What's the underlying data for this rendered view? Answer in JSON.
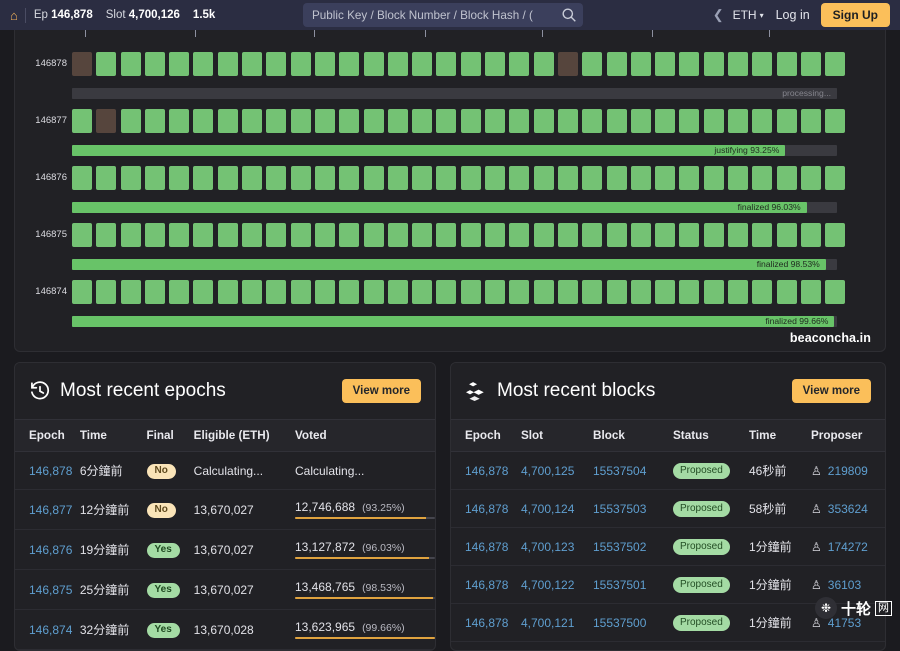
{
  "nav": {
    "home_icon": "home-icon",
    "epoch_label": "Ep",
    "epoch_value": "146,878",
    "slot_label": "Slot",
    "slot_value": "4,700,126",
    "peers": "1.5k",
    "search_placeholder": "Public Key / Block Number / Block Hash / (",
    "search_icon": "search-icon",
    "back_icon": "chevron-left-icon",
    "network": "ETH",
    "network_caret": "▾",
    "login": "Log in",
    "signup": "Sign Up"
  },
  "chart": {
    "watermark": "beaconcha.in",
    "slot_count": 32,
    "rows": [
      {
        "epoch": "146878",
        "missed_indexes": [
          0,
          20
        ],
        "bar_percent": 0,
        "bar_state": "idle",
        "bar_label": "processing..."
      },
      {
        "epoch": "146877",
        "missed_indexes": [
          1
        ],
        "bar_percent": 93.25,
        "bar_state": "justifying",
        "bar_label": "justifying 93.25%"
      },
      {
        "epoch": "146876",
        "missed_indexes": [],
        "bar_percent": 96.03,
        "bar_state": "finalized",
        "bar_label": "finalized 96.03%"
      },
      {
        "epoch": "146875",
        "missed_indexes": [],
        "bar_percent": 98.53,
        "bar_state": "finalized",
        "bar_label": "finalized 98.53%"
      },
      {
        "epoch": "146874",
        "missed_indexes": [],
        "bar_percent": 99.66,
        "bar_state": "finalized",
        "bar_label": "finalized 99.66%"
      }
    ]
  },
  "epochs_card": {
    "icon": "history-clock-icon",
    "title": "Most recent epochs",
    "view_more": "View more",
    "columns": [
      "Epoch",
      "Time",
      "Final",
      "Eligible (ETH)",
      "Voted"
    ],
    "rows": [
      {
        "epoch": "146,878",
        "time": "6分鐘前",
        "final": "No",
        "final_state": "no",
        "eligible": "Calculating...",
        "voted": "Calculating...",
        "voted_pct": "",
        "voted_bar": 0
      },
      {
        "epoch": "146,877",
        "time": "12分鐘前",
        "final": "No",
        "final_state": "no",
        "eligible": "13,670,027",
        "voted": "12,746,688",
        "voted_pct": "(93.25%)",
        "voted_bar": 93.25
      },
      {
        "epoch": "146,876",
        "time": "19分鐘前",
        "final": "Yes",
        "final_state": "yes",
        "eligible": "13,670,027",
        "voted": "13,127,872",
        "voted_pct": "(96.03%)",
        "voted_bar": 96.03
      },
      {
        "epoch": "146,875",
        "time": "25分鐘前",
        "final": "Yes",
        "final_state": "yes",
        "eligible": "13,670,027",
        "voted": "13,468,765",
        "voted_pct": "(98.53%)",
        "voted_bar": 98.53
      },
      {
        "epoch": "146,874",
        "time": "32分鐘前",
        "final": "Yes",
        "final_state": "yes",
        "eligible": "13,670,028",
        "voted": "13,623,965",
        "voted_pct": "(99.66%)",
        "voted_bar": 99.66
      }
    ]
  },
  "blocks_card": {
    "icon": "blocks-cubes-icon",
    "title": "Most recent blocks",
    "view_more": "View more",
    "columns": [
      "Epoch",
      "Slot",
      "Block",
      "Status",
      "Time",
      "Proposer"
    ],
    "rows": [
      {
        "epoch": "146,878",
        "slot": "4,700,125",
        "block": "15537504",
        "status": "Proposed",
        "time": "46秒前",
        "proposer": "219809"
      },
      {
        "epoch": "146,878",
        "slot": "4,700,124",
        "block": "15537503",
        "status": "Proposed",
        "time": "58秒前",
        "proposer": "353624"
      },
      {
        "epoch": "146,878",
        "slot": "4,700,123",
        "block": "15537502",
        "status": "Proposed",
        "time": "1分鐘前",
        "proposer": "174272"
      },
      {
        "epoch": "146,878",
        "slot": "4,700,122",
        "block": "15537501",
        "status": "Proposed",
        "time": "1分鐘前",
        "proposer": "36103"
      },
      {
        "epoch": "146,878",
        "slot": "4,700,121",
        "block": "15537500",
        "status": "Proposed",
        "time": "1分鐘前",
        "proposer": "41753"
      }
    ]
  },
  "overlay_watermark": {
    "text": "十轮",
    "boxed": "网"
  },
  "colors": {
    "accent": "#fbbf5a",
    "link": "#5f9fd0",
    "slot_ok": "#74c274",
    "slot_miss": "#56453d",
    "bar_green": "#68c368",
    "bar_orange": "#e0a33f",
    "navbar": "#2b2d42",
    "panel": "#212125",
    "page_bg": "#1b1b1f"
  }
}
